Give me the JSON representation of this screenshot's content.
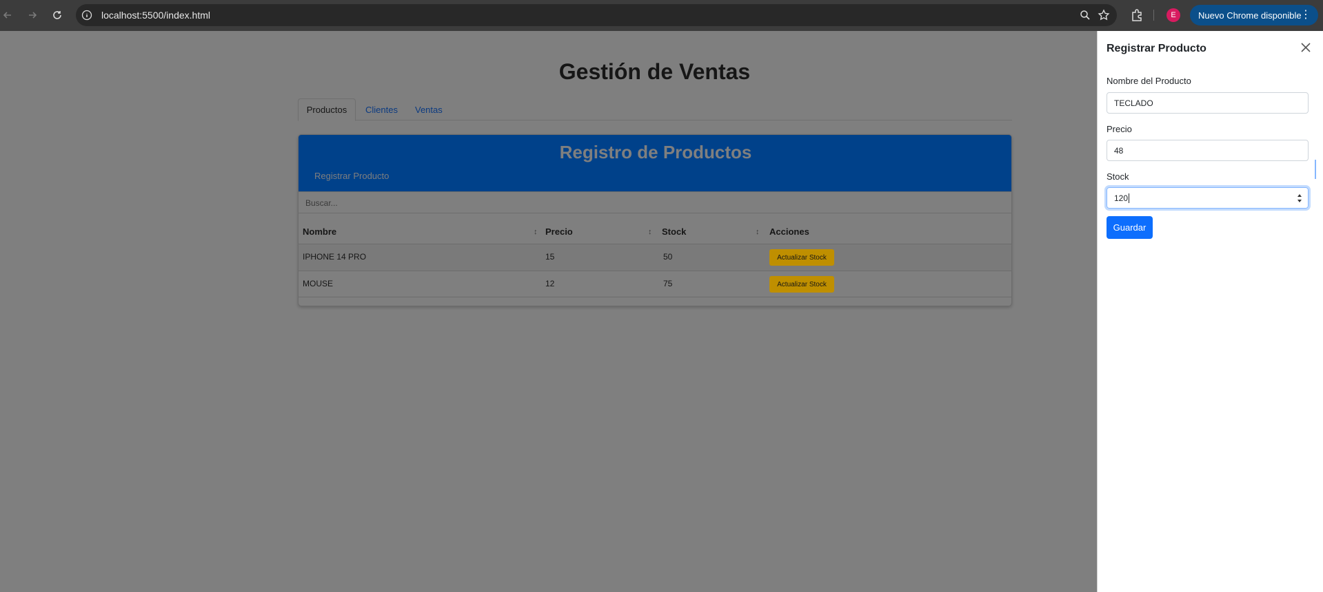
{
  "browser": {
    "url": "localhost:5500/index.html",
    "profile_initial": "E",
    "update_label": "Nuevo Chrome disponible",
    "menu_icon": "more-vert-icon"
  },
  "page": {
    "title": "Gestión de Ventas",
    "tabs": [
      {
        "label": "Productos",
        "active": true
      },
      {
        "label": "Clientes",
        "active": false
      },
      {
        "label": "Ventas",
        "active": false
      }
    ],
    "card": {
      "title": "Registro de Productos",
      "register_link": "Registrar Producto",
      "search_placeholder": "Buscar...",
      "columns": [
        "Nombre",
        "Precio",
        "Stock",
        "Acciones"
      ],
      "rows": [
        {
          "nombre": "IPHONE 14 PRO",
          "precio": "15",
          "stock": "50",
          "accion": "Actualizar Stock"
        },
        {
          "nombre": "MOUSE",
          "precio": "12",
          "stock": "75",
          "accion": "Actualizar Stock"
        }
      ]
    }
  },
  "offcanvas": {
    "title": "Registrar Producto",
    "fields": {
      "nombre_label": "Nombre del Producto",
      "nombre_value": "TECLADO",
      "precio_label": "Precio",
      "precio_value": "48",
      "stock_label": "Stock",
      "stock_value": "120"
    },
    "save_label": "Guardar"
  },
  "colors": {
    "header_blue": "#00418a",
    "primary": "#0d6efd",
    "warning": "#bf8f00",
    "backdrop": "#7f7f7f"
  }
}
